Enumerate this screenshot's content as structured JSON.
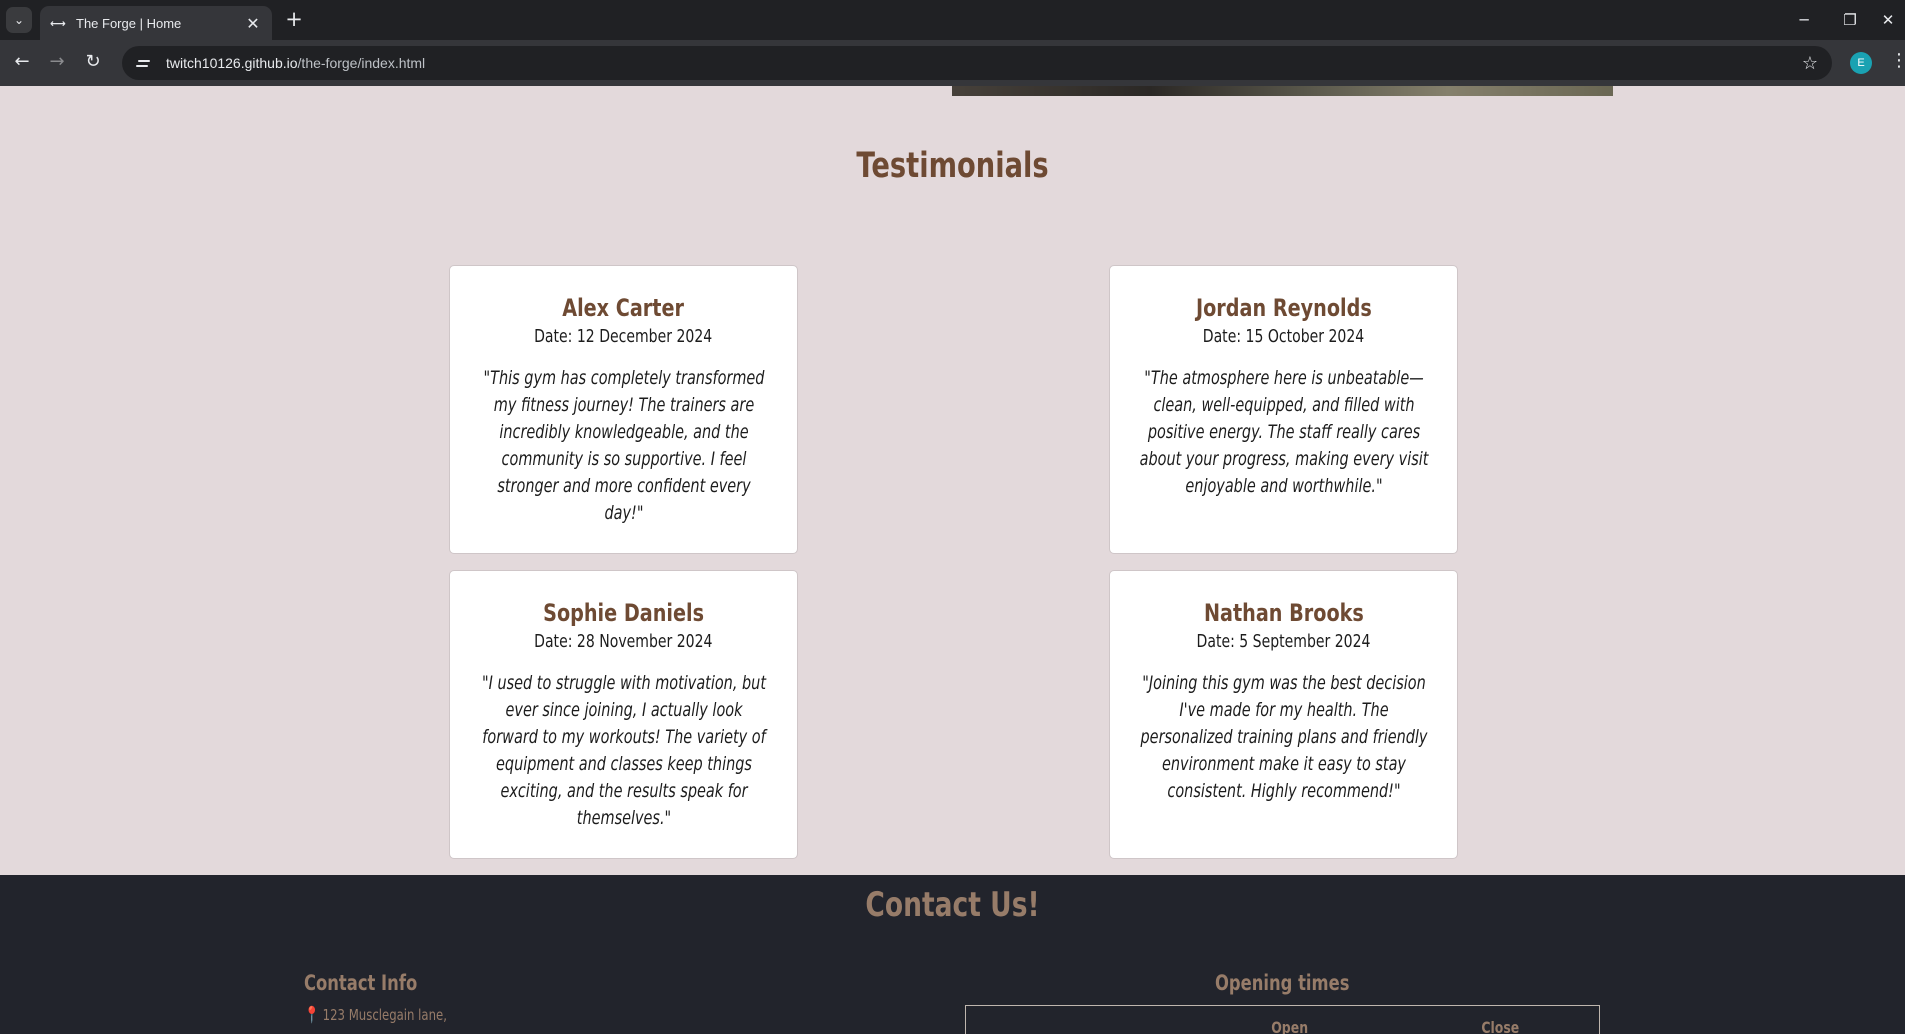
{
  "browser": {
    "tab_title": "The Forge | Home",
    "url_host": "twitch10126.github.io",
    "url_path": "/the-forge/index.html",
    "profile_initial": "E"
  },
  "testimonials": {
    "title": "Testimonials",
    "cards": [
      {
        "name": "Alex Carter",
        "date": "Date: 12 December 2024",
        "quote": "\"This gym has completely transformed my fitness journey! The trainers are incredibly knowledgeable, and the community is so supportive. I feel stronger and more confident every day!\""
      },
      {
        "name": "Jordan Reynolds",
        "date": "Date: 15 October 2024",
        "quote": "\"The atmosphere here is unbeatable—clean, well-equipped, and filled with positive energy. The staff really cares about your progress, making every visit enjoyable and worthwhile.\""
      },
      {
        "name": "Sophie Daniels",
        "date": "Date: 28 November 2024",
        "quote": "\"I used to struggle with motivation, but ever since joining, I actually look forward to my workouts! The variety of equipment and classes keep things exciting, and the results speak for themselves.\""
      },
      {
        "name": "Nathan Brooks",
        "date": "Date: 5 September 2024",
        "quote": "\"Joining this gym was the best decision I've made for my health. The personalized training plans and friendly environment make it easy to stay consistent. Highly recommend!\""
      }
    ]
  },
  "contact": {
    "title": "Contact Us!",
    "info_title": "Contact Info",
    "address_line": "123 Musclegain lane,",
    "opening_title": "Opening times",
    "table_headers": [
      "Open",
      "Close"
    ]
  }
}
